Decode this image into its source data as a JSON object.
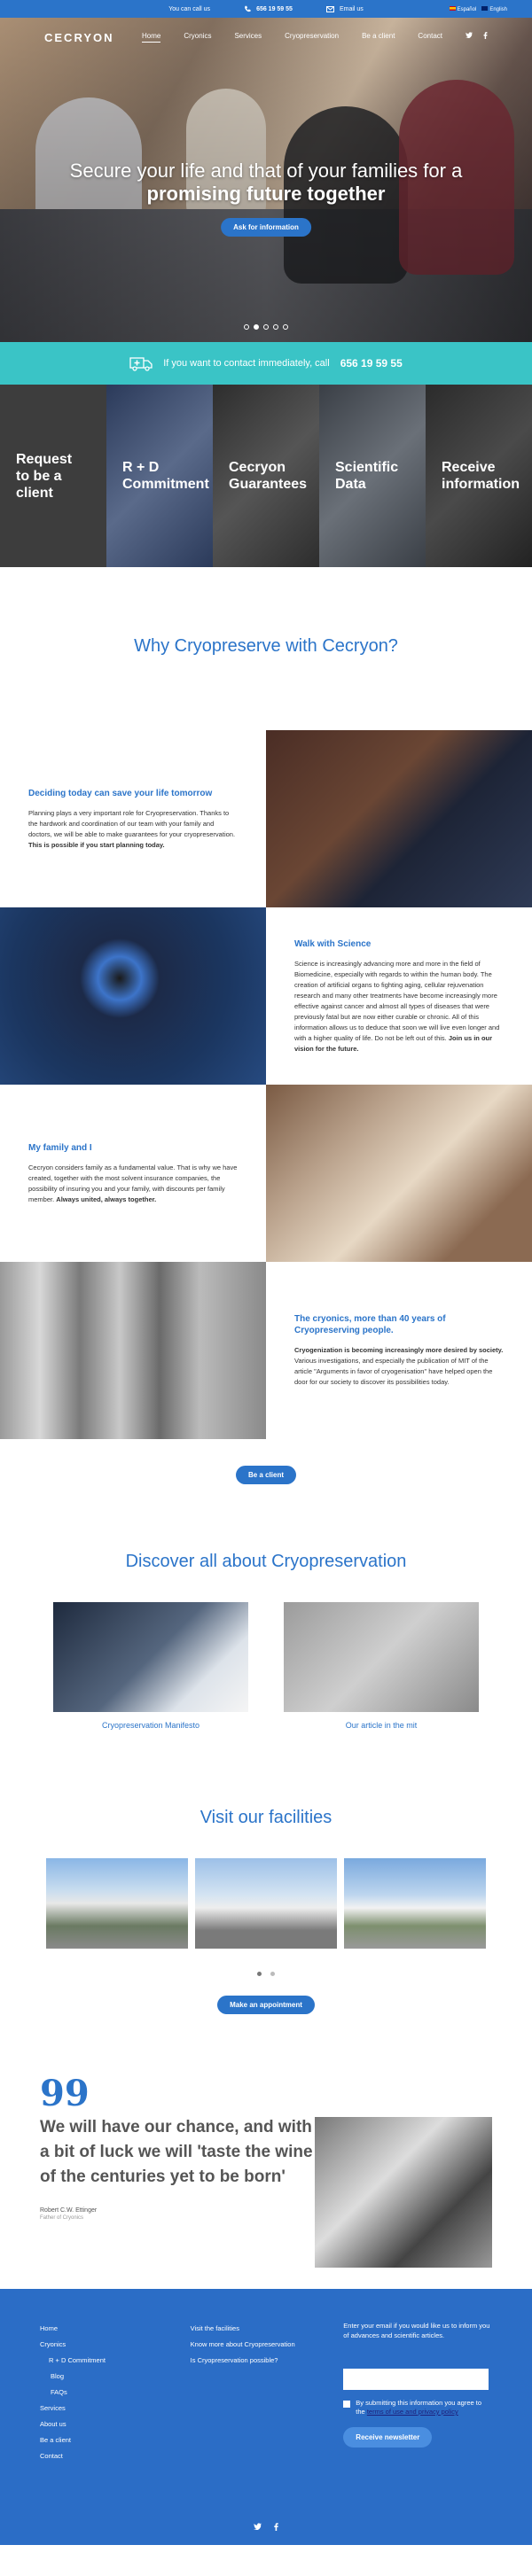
{
  "topbar": {
    "call_label": "You can call us",
    "phone": "656 19 59 55",
    "email_label": "Email us",
    "lang_es": "Español",
    "lang_en": "English"
  },
  "nav": {
    "logo": "CECRYON",
    "items": [
      "Home",
      "Cryonics",
      "Services",
      "Cryopreservation",
      "Be a client",
      "Contact"
    ]
  },
  "hero": {
    "title_line1": "Secure your life and that of your families for a",
    "title_line2": "promising future together",
    "cta": "Ask for information",
    "slides_total": 5,
    "active_slide": 2
  },
  "contact_bar": {
    "text": "If you want to contact immediately, call",
    "phone": "656 19 59 55"
  },
  "tiles": [
    {
      "label": "Request to be a client"
    },
    {
      "label": "R + D Commitment"
    },
    {
      "label": "Cecryon Guarantees"
    },
    {
      "label": "Scientific Data"
    },
    {
      "label": "Receive information"
    }
  ],
  "why": {
    "title": "Why Cryopreserve with Cecryon?"
  },
  "blocks": [
    {
      "title": "Deciding today can save your life tomorrow",
      "body": "Planning plays a very important role for Cryopreservation. Thanks to the hardwork and coordination of our team with your family and doctors, we will be able to make guarantees for your cryopreservation.",
      "bold": "This is possible if you start planning today."
    },
    {
      "title": "Walk with Science",
      "body": "Science is increasingly advancing more and more in the field of Biomedicine, especially with regards to within the human body. The creation of artificial organs to fighting aging, cellular rejuvenation research and many other treatments have become increasingly more effective against cancer and almost all types of diseases that were previously fatal but are now either curable or chronic. All of this information allows us to deduce that soon we will live even longer and with a higher quality of life. Do not be left out of this.",
      "bold": "Join us in our vision for the future."
    },
    {
      "title": "My family and I",
      "body": "Cecryon considers family as a fundamental value. That is why we have created, together with the most solvent insurance companies, the possibility of insuring you and your family, with discounts per family member.",
      "bold": "Always united, always together."
    },
    {
      "title": "The cryonics, more than 40 years of Cryopreserving people.",
      "bold": "Cryogenization is becoming increasingly more desired by society.",
      "body": "Various investigations, and especially the publication of MIT of the article \"Arguments in favor of cryogenisation\" have helped open the door for our society to discover its possibilities today."
    }
  ],
  "be_client": "Be a client",
  "discover": {
    "title": "Discover all about Cryopreservation",
    "cards": [
      "Cryopreservation Manifesto",
      "Our article in the mit"
    ]
  },
  "facilities": {
    "title": "Visit our facilities",
    "cta": "Make an appointment"
  },
  "quote": {
    "mark": "99",
    "text": "We will have our chance, and with a bit of luck we will 'taste the wine of the centuries yet to be born'",
    "author": "Robert C.W. Ettinger",
    "role": "Father of Cryonics"
  },
  "footer": {
    "col1": [
      "Home",
      "Cryonics",
      "R + D Commitment",
      "Blog",
      "FAQs",
      "Services",
      "About us",
      "Be a client",
      "Contact"
    ],
    "col2": [
      "Visit the facilities",
      "Know more about Cryopreservation",
      "Is Cryopreservation possible?"
    ],
    "newsletter_text": "Enter your email if you would like us to inform you of advances and scientific articles.",
    "consent_text": "By submitting this information you agree to the",
    "consent_link": "terms of use and privacy policy",
    "submit": "Receive newsletter"
  },
  "colors": {
    "primary": "#2b74c9",
    "teal": "#3ac4c6",
    "footer": "#2b6dc6"
  }
}
